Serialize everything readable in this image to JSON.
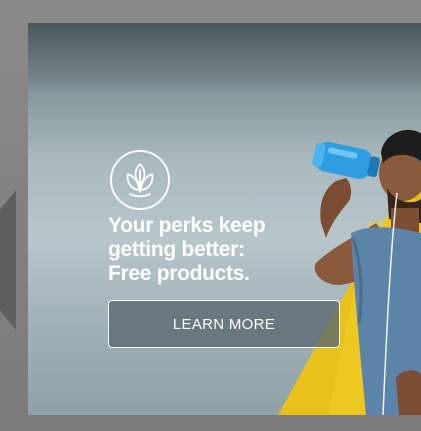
{
  "banner": {
    "icon": "leaf-sprout-icon",
    "headline_lines": [
      "Your perks keep",
      "getting better:",
      "Free products."
    ],
    "cta_label": "LEARN MORE"
  },
  "colors": {
    "accent_yellow": "#e8c21a",
    "bottle_blue": "#2f9ee0",
    "text": "#ffffff"
  }
}
